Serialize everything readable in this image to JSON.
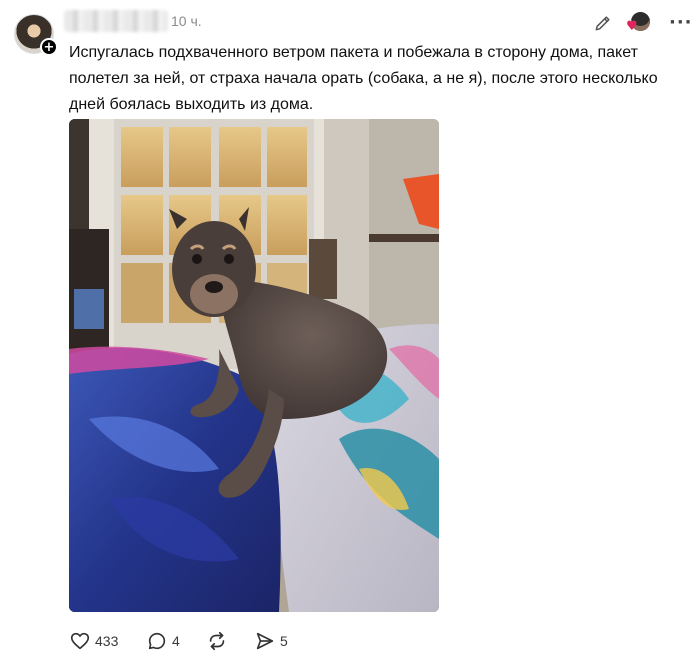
{
  "post": {
    "time": "10 ч.",
    "text": "Испугалась подхваченного ветром пакета и побежала в сторону дома, пакет полетел за ней, от страха начала орать (собака, а не я), после этого несколько дней боялась выходить из дома.",
    "follow_symbol": "+",
    "more_symbol": "···",
    "heart_symbol": "♥"
  },
  "actions": {
    "likes": "433",
    "replies": "4",
    "reposts": "",
    "shares": "5"
  },
  "icons": {
    "avatar": "user-avatar",
    "follow": "plus-icon",
    "edit": "pencil-icon",
    "more": "more-dots-icon",
    "like": "heart-icon",
    "reply": "comment-bubble-icon",
    "repost": "repost-arrows-icon",
    "share": "send-icon"
  },
  "colors": {
    "text": "#101010",
    "muted": "#8a8a8a",
    "heart_accent": "#e0245e"
  }
}
